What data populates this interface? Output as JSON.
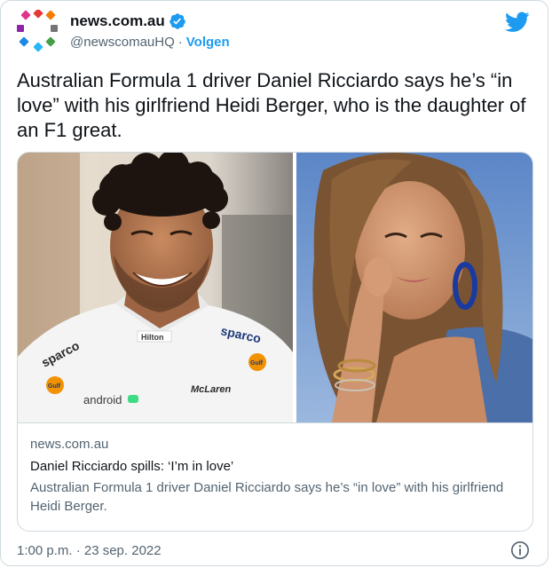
{
  "account": {
    "display_name": "news.com.au",
    "handle": "@newscomauHQ",
    "separator": "·",
    "follow_label": "Volgen",
    "verified_icon": "verified-badge-icon",
    "brand_color": "#1d9bf0"
  },
  "tweet": {
    "text": "Australian Formula 1 driver Daniel Ricciardo says he’s “in love” with his girlfriend Heidi Berger, who is the daughter of an F1 great."
  },
  "card": {
    "domain": "news.com.au",
    "title": "Daniel Ricciardo spills: ‘I’m in love’",
    "description": "Australian Formula 1 driver Daniel Ricciardo says he’s “in love” with his girlfriend Heidi Berger.",
    "left_photo": {
      "shirt_labels": [
        "sparco",
        "Hilton",
        "sparco",
        "Gulf",
        "Gulf",
        "android",
        "McLaren"
      ]
    }
  },
  "footer": {
    "timestamp": "1:00 p.m. · 23 sep. 2022",
    "info_icon": "info-icon"
  }
}
